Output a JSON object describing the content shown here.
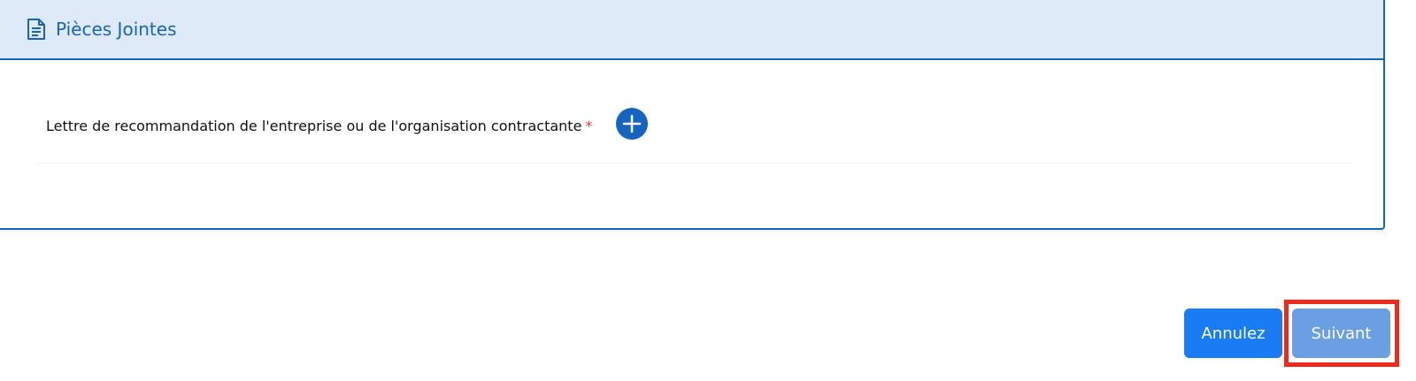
{
  "section": {
    "title": "Pièces Jointes",
    "icon": "document-icon"
  },
  "field": {
    "label": "Lettre de recommandation de l'entreprise ou de l'organisation contractante",
    "required_mark": "*",
    "add_icon": "plus-circle-icon"
  },
  "actions": {
    "cancel_label": "Annulez",
    "next_label": "Suivant"
  },
  "colors": {
    "primary": "#1565c0",
    "header_bg": "#deeaf7",
    "cancel_button": "#1a7cf4",
    "next_button": "#6a9fe4",
    "required": "#e53935",
    "highlight": "#ee2a1a"
  }
}
